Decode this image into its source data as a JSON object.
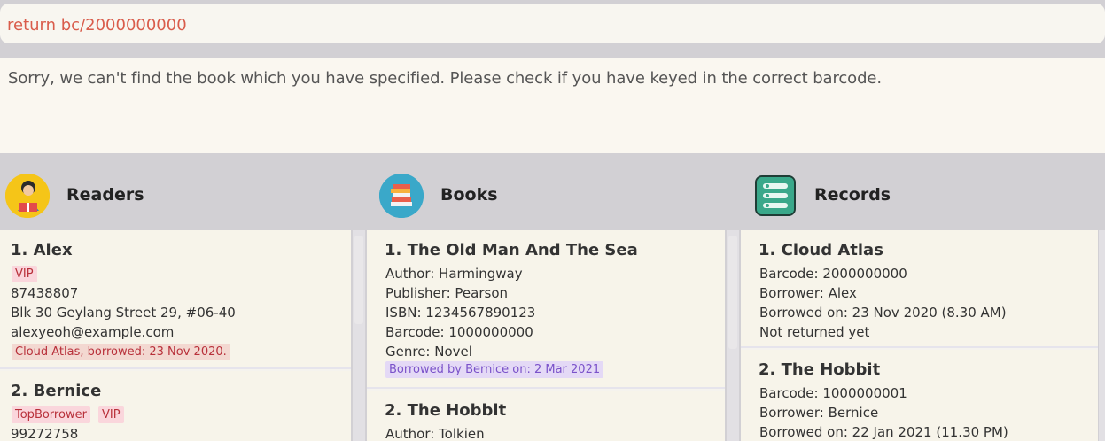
{
  "command": {
    "value": "return bc/2000000000"
  },
  "result": {
    "message": "Sorry, we can't find the book which you have specified. Please check if you have keyed in the correct barcode."
  },
  "columns": {
    "readers": {
      "title": "Readers",
      "icon": "reader-icon",
      "items": [
        {
          "index_name": "1.  Alex",
          "tags": [
            "VIP"
          ],
          "phone": "87438807",
          "address": "Blk 30 Geylang Street 29, #06-40",
          "email": "alexyeoh@example.com",
          "borrowed": "Cloud Atlas, borrowed: 23 Nov 2020."
        },
        {
          "index_name": "2.  Bernice",
          "tags": [
            "TopBorrower",
            "VIP"
          ],
          "phone": "99272758"
        }
      ]
    },
    "books": {
      "title": "Books",
      "icon": "books-icon",
      "items": [
        {
          "index_name": "1.  The Old Man And The Sea",
          "author": "Author: Harmingway",
          "publisher": "Publisher: Pearson",
          "isbn": "ISBN: 1234567890123",
          "barcode": "Barcode: 1000000000",
          "genre": "Genre: Novel",
          "status": "Borrowed by Bernice on: 2 Mar 2021"
        },
        {
          "index_name": "2.  The Hobbit",
          "author": "Author: Tolkien"
        }
      ]
    },
    "records": {
      "title": "Records",
      "icon": "records-icon",
      "items": [
        {
          "index_name": "1.  Cloud Atlas",
          "barcode": "Barcode: 2000000000",
          "borrower": "Borrower: Alex",
          "borrowed_on": "Borrowed on: 23 Nov 2020 (8.30 AM)",
          "returned": "Not returned yet"
        },
        {
          "index_name": "2.  The Hobbit",
          "barcode": "Barcode: 1000000001",
          "borrower": "Borrower: Bernice",
          "borrowed_on": "Borrowed on: 22 Jan 2021 (11.30 PM)"
        }
      ]
    }
  },
  "colors": {
    "command_text": "#d95c4b",
    "tag_pink": "#fad6dc",
    "tag_purple": "#e4d9f6"
  }
}
